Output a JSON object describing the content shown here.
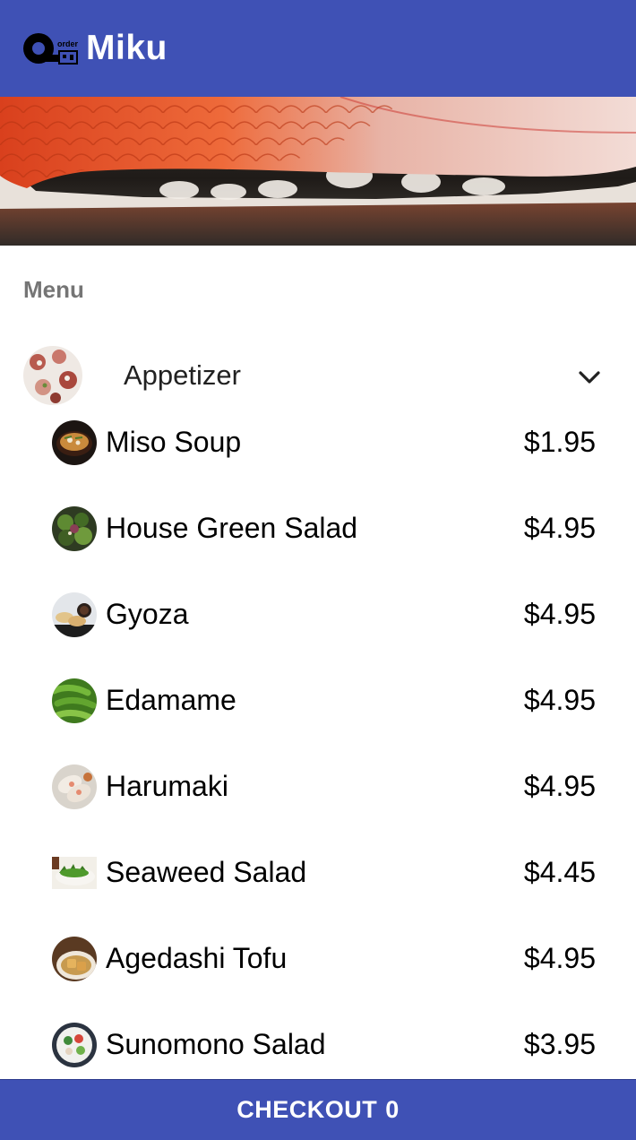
{
  "app_bar": {
    "title": "Miku",
    "logo_icon": "qr-order-logo",
    "logo_text": "order"
  },
  "hero": {
    "icon": "sushi-hero-photo"
  },
  "menu": {
    "section_label": "Menu",
    "category": {
      "label": "Appetizer",
      "icon": "appetizer-photo",
      "expanded": true,
      "chevron_icon": "chevron-down-icon"
    },
    "items": [
      {
        "name": "Miso Soup",
        "price": "$1.95",
        "icon": "miso-soup-photo"
      },
      {
        "name": "House Green Salad",
        "price": "$4.95",
        "icon": "green-salad-photo"
      },
      {
        "name": "Gyoza",
        "price": "$4.95",
        "icon": "gyoza-photo"
      },
      {
        "name": "Edamame",
        "price": "$4.95",
        "icon": "edamame-photo"
      },
      {
        "name": "Harumaki",
        "price": "$4.95",
        "icon": "harumaki-photo"
      },
      {
        "name": "Seaweed Salad",
        "price": "$4.45",
        "icon": "seaweed-salad-photo"
      },
      {
        "name": "Agedashi Tofu",
        "price": "$4.95",
        "icon": "agedashi-tofu-photo"
      },
      {
        "name": "Sunomono Salad",
        "price": "$3.95",
        "icon": "sunomono-salad-photo"
      }
    ]
  },
  "checkout": {
    "label": "CHECKOUT",
    "count": "0"
  },
  "colors": {
    "primary": "#3f51b5",
    "on_primary": "#ffffff",
    "section_label": "#757575"
  }
}
